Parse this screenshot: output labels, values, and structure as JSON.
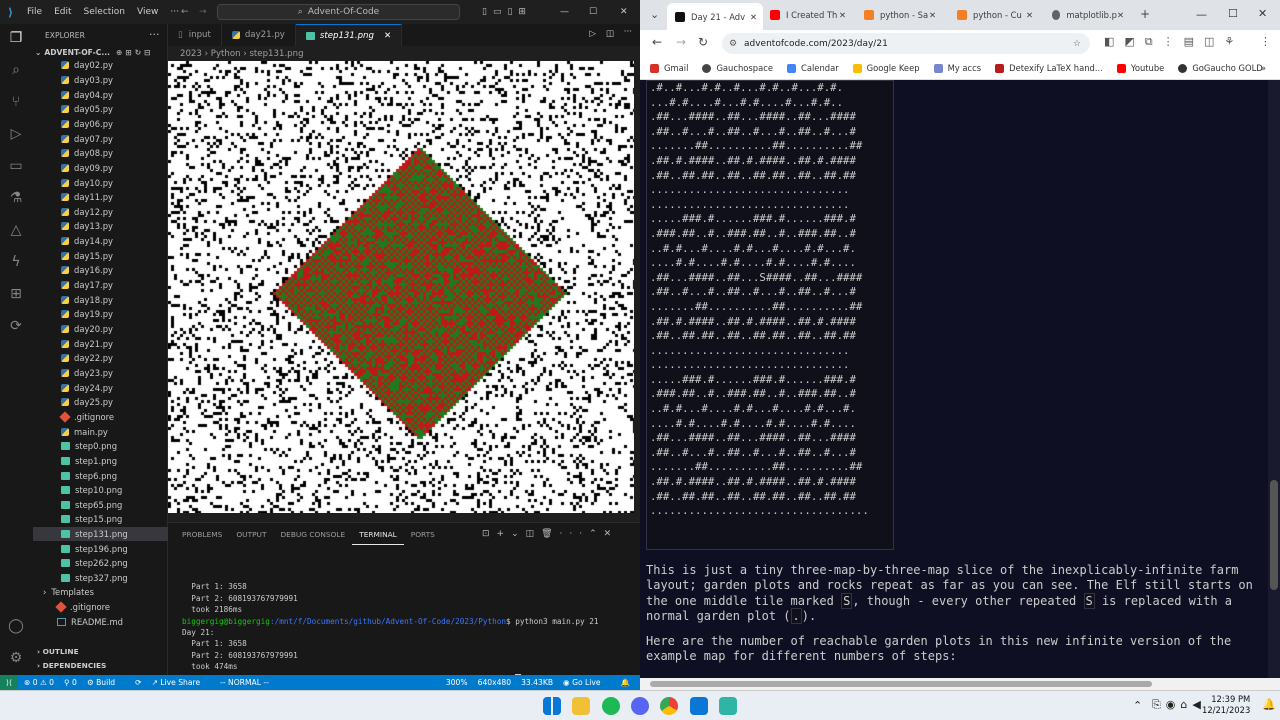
{
  "vscode": {
    "menu": [
      "File",
      "Edit",
      "Selection",
      "View",
      "···"
    ],
    "search_text": "Advent-Of-Code",
    "explorer_title": "EXPLORER",
    "root_folder": "ADVENT-OF-C...",
    "files": [
      "day02.py",
      "day03.py",
      "day04.py",
      "day05.py",
      "day06.py",
      "day07.py",
      "day08.py",
      "day09.py",
      "day10.py",
      "day11.py",
      "day12.py",
      "day13.py",
      "day14.py",
      "day15.py",
      "day16.py",
      "day17.py",
      "day18.py",
      "day19.py",
      "day20.py",
      "day21.py",
      "day22.py",
      "day23.py",
      "day24.py",
      "day25.py",
      ".gitignore",
      "main.py",
      "step0.png",
      "step1.png",
      "step6.png",
      "step10.png",
      "step65.png",
      "step15.png",
      "step131.png",
      "step196.png",
      "step262.png",
      "step327.png"
    ],
    "selected_file": "step131.png",
    "templates_folder": "Templates",
    "root_files": [
      ".gitignore",
      "README.md"
    ],
    "outline": "OUTLINE",
    "dependencies": "DEPENDENCIES",
    "tabs": [
      "input",
      "day21.py",
      "step131.png"
    ],
    "active_tab": "step131.png",
    "breadcrumb": "2023 › Python › step131.png",
    "panel_tabs": [
      "PROBLEMS",
      "OUTPUT",
      "DEBUG CONSOLE",
      "TERMINAL",
      "PORTS"
    ],
    "active_panel_tab": "TERMINAL",
    "terminal": {
      "line1": "  Part 1: 3658",
      "line2": "  Part 2: 608193767979991",
      "line3": "  took 2186ms",
      "prompt_user": "biggergig@biggergig",
      "prompt_path": ":/mnt/f/Documents/github/Advent-Of-Code/2023/Python",
      "command": "$ python3 main.py 21",
      "line5": "Day 21:",
      "line6": "  Part 1: 3658",
      "line7": "  Part 2: 608193767979991",
      "line8": "  took 474ms",
      "final_prompt_end": "$ "
    },
    "status": {
      "errors": "⊗ 0 ⚠ 0",
      "ports": "⚲ 0",
      "build": "Build",
      "live_share": "Live Share",
      "mode": "-- NORMAL --",
      "zoom": "300%",
      "dims": "640x480",
      "size": "33.43KB",
      "go_live": "Go Live"
    }
  },
  "chrome": {
    "tabs": [
      "Day 21 - Adv",
      "I Created Th",
      "python - Sa",
      "python - Cu",
      "matplotlib.p"
    ],
    "url": "adventofcode.com/2023/day/21",
    "bookmarks": [
      "Gmail",
      "Gauchospace",
      "Calendar",
      "Google Keep",
      "My accs",
      "Detexify LaTeX hand...",
      "Youtube",
      "GoGaucho GOLD"
    ],
    "grid_lines": [
      ".#..#...#.#..#...#.#..#...#.#.",
      "...#.#....#...#.#....#...#.#..",
      ".##...####..##...####..##...####",
      ".##..#...#..##..#...#..##..#...#",
      ".......##..........##..........##",
      ".##.#.####..##.#.####..##.#.####",
      ".##..##.##..##..##.##..##..##.##",
      "...............................",
      "...............................",
      ".....###.#......###.#......###.#",
      ".###.##..#..###.##..#..###.##..#",
      "..#.#...#....#.#...#....#.#...#.",
      "....#.#....#.#....#.#....#.#....",
      ".##...####..##...S####..##...####",
      ".##..#...#..##..#...#..##..#...#",
      ".......##..........##..........##",
      ".##.#.####..##.#.####..##.#.####",
      ".##..##.##..##..##.##..##..##.##",
      "...............................",
      "...............................",
      ".....###.#......###.#......###.#",
      ".###.##..#..###.##..#..###.##..#",
      "..#.#...#....#.#...#....#.#...#.",
      "....#.#....#.#....#.#....#.#....",
      ".##...####..##...####..##...####",
      ".##..#...#..##..#...#..##..#...#",
      ".......##..........##..........##",
      ".##.#.####..##.#.####..##.#.####",
      ".##..##.##..##..##.##..##..##.##",
      ".................................."
    ],
    "para1_a": "This is just a tiny three-map-by-three-map slice of the inexplicably-infinite farm layout; garden plots and rocks repeat as far as you can see. The Elf still starts on the one middle tile marked ",
    "para1_s": "S",
    "para1_b": ", though - every other repeated ",
    "para1_c": " is replaced with a normal garden plot (",
    "para1_dot": ".",
    "para1_d": ").",
    "para2": "Here are the number of reachable garden plots in this new infinite version of the example map for different numbers of steps:"
  },
  "taskbar": {
    "time": "12:39 PM",
    "date": "12/21/2023"
  },
  "colors": {
    "vscode_accent": "#007acc",
    "aoc_bg": "#0f0f23",
    "diamond_red": "#c01818",
    "diamond_green": "#1f7a1f"
  }
}
